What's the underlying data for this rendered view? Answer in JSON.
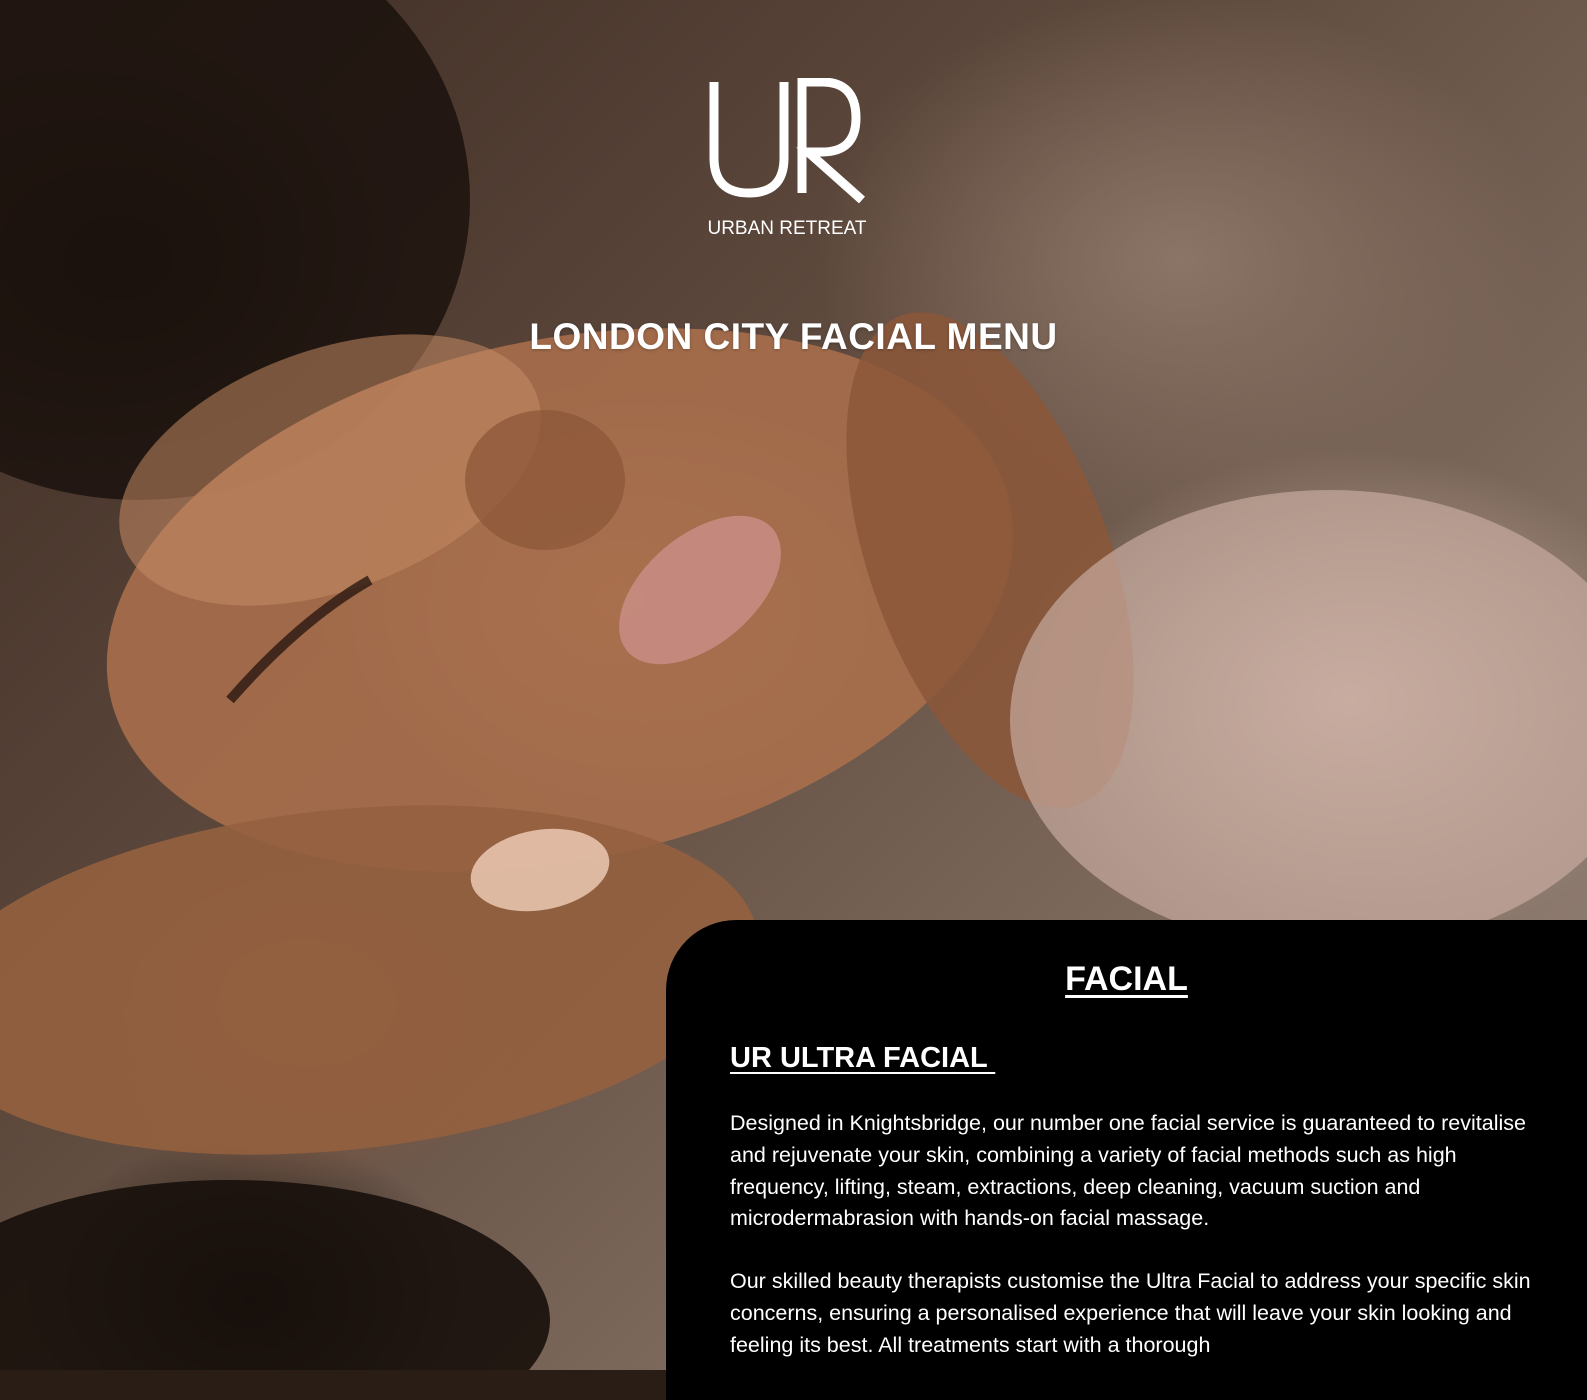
{
  "brand": {
    "logo_mark": "UR",
    "name": "URBAN RETREAT"
  },
  "page": {
    "title": "LONDON CITY FACIAL MENU"
  },
  "hero": {
    "image": "facial-massage-photo"
  },
  "section": {
    "title": "FACIAL",
    "treatment": {
      "title": "UR ULTRA FACIAL ",
      "paragraphs": [
        "Designed in Knightsbridge, our number one facial service is guaranteed to revitalise and rejuvenate your skin, combining a variety of facial methods such as high frequency, lifting, steam, extractions, deep cleaning, vacuum suction and microdermabrasion with hands-on facial massage.",
        "Our skilled beauty therapists customise the Ultra Facial to address your specific skin concerns, ensuring a personalised experience that will leave your skin looking and feeling its best. All treatments start with a thorough"
      ]
    }
  },
  "colors": {
    "panel_background": "#000000",
    "text": "#ffffff"
  }
}
